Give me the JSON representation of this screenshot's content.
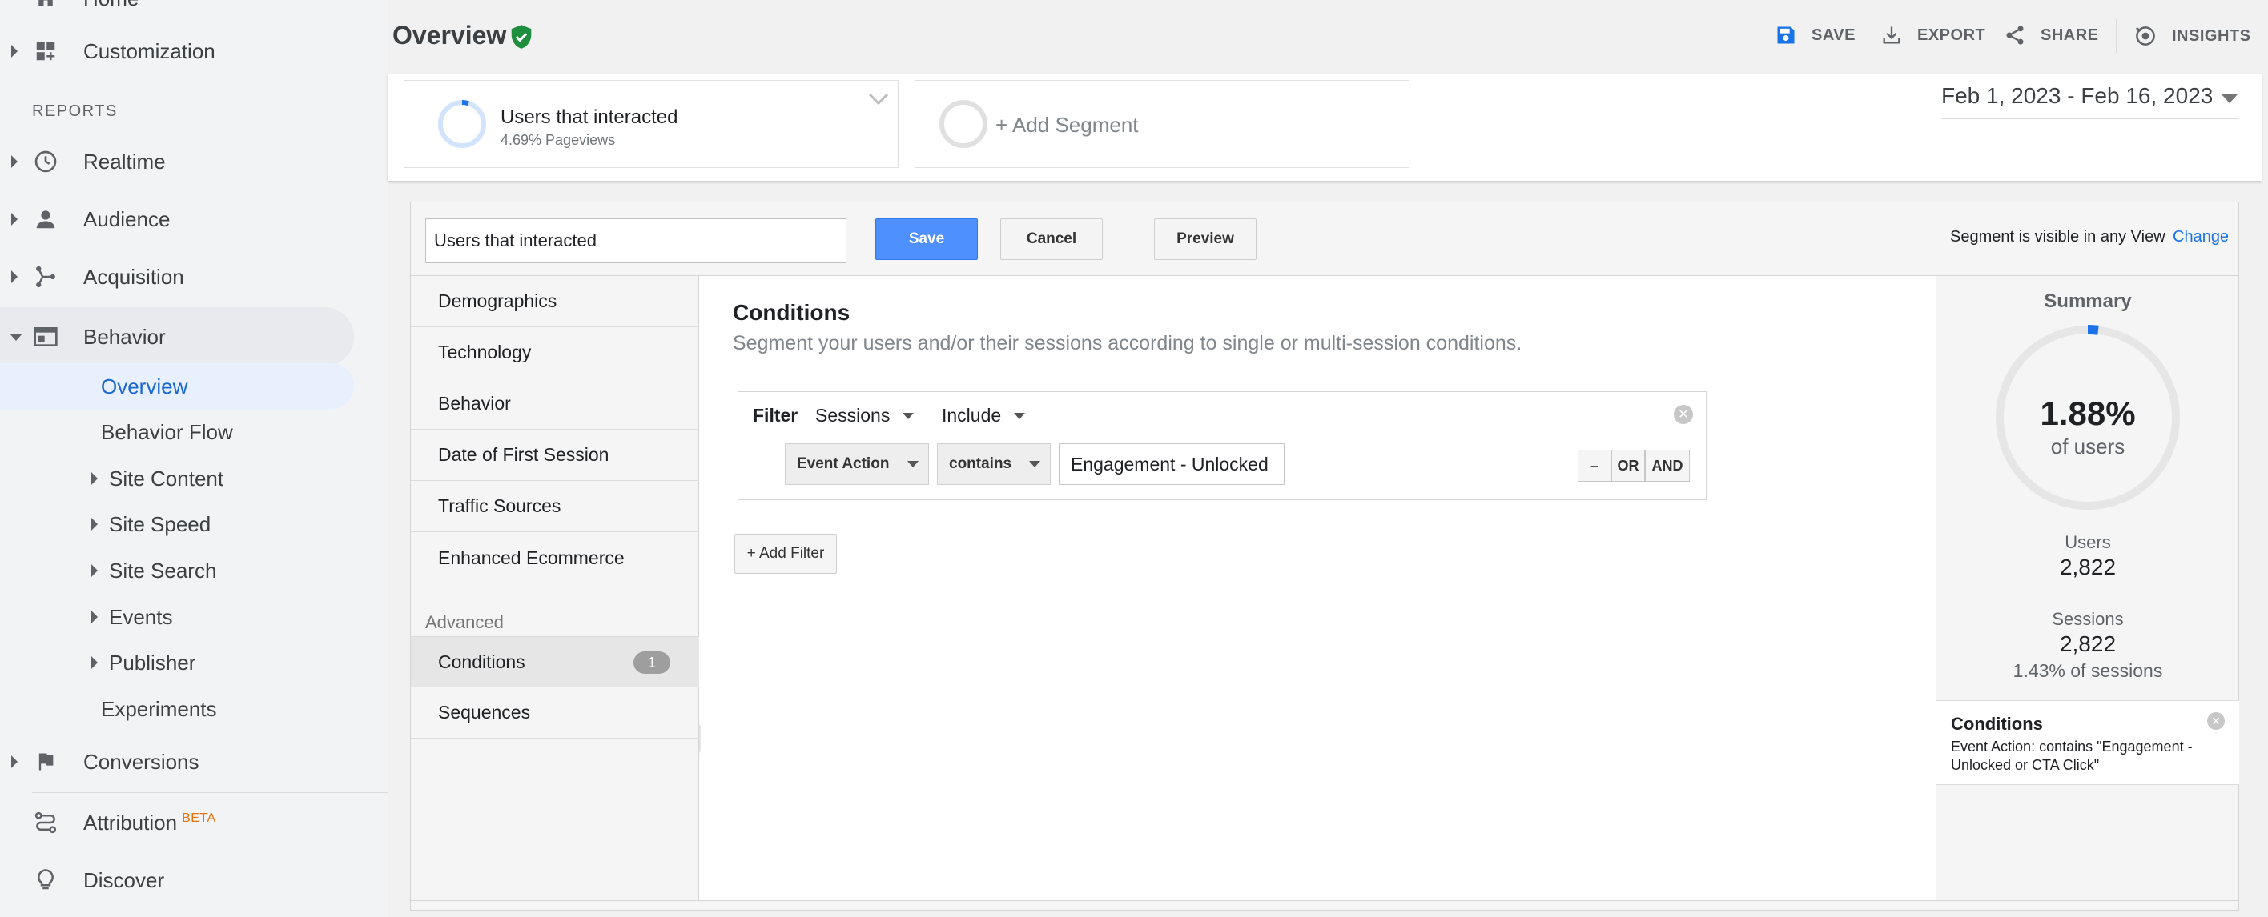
{
  "sidebar": {
    "home_label": "Home",
    "customization_label": "Customization",
    "reports_heading": "REPORTS",
    "realtime_label": "Realtime",
    "audience_label": "Audience",
    "acquisition_label": "Acquisition",
    "behavior_label": "Behavior",
    "behavior_items": [
      {
        "label": "Overview"
      },
      {
        "label": "Behavior Flow"
      },
      {
        "label": "Site Content"
      },
      {
        "label": "Site Speed"
      },
      {
        "label": "Site Search"
      },
      {
        "label": "Events"
      },
      {
        "label": "Publisher"
      },
      {
        "label": "Experiments"
      }
    ],
    "conversions_label": "Conversions",
    "attribution_label": "Attribution",
    "attribution_badge": "BETA",
    "discover_label": "Discover"
  },
  "header": {
    "title": "Overview",
    "tools": {
      "save": "SAVE",
      "export": "EXPORT",
      "share": "SHARE",
      "insights": "INSIGHTS"
    }
  },
  "segments": {
    "active_name": "Users that interacted",
    "active_sub": "4.69% Pageviews",
    "add_label": "+ Add Segment"
  },
  "date_range": "Feb 1, 2023 - Feb 16, 2023",
  "editor": {
    "segment_name": "Users that interacted",
    "save_label": "Save",
    "cancel_label": "Cancel",
    "preview_label": "Preview",
    "visibility_text": "Segment is visible in any View",
    "change_label": "Change",
    "categories": [
      {
        "label": "Demographics"
      },
      {
        "label": "Technology"
      },
      {
        "label": "Behavior"
      },
      {
        "label": "Date of First Session"
      },
      {
        "label": "Traffic Sources"
      },
      {
        "label": "Enhanced Ecommerce"
      }
    ],
    "advanced_heading": "Advanced",
    "advanced_items": [
      {
        "label": "Conditions",
        "count": "1"
      },
      {
        "label": "Sequences"
      }
    ],
    "conditions": {
      "title": "Conditions",
      "description": "Segment your users and/or their sessions according to single or multi-session conditions.",
      "filter_label": "Filter",
      "scope": "Sessions",
      "mode": "Include",
      "dimension": "Event Action",
      "operator": "contains",
      "value": "Engagement - Unlocked",
      "minus_label": "–",
      "or_label": "OR",
      "and_label": "AND",
      "add_filter_label": "+ Add Filter"
    },
    "summary": {
      "title": "Summary",
      "percent": "1.88%",
      "percent_sub": "of users",
      "percent_value": 1.88,
      "users_label": "Users",
      "users_value": "2,822",
      "sessions_label": "Sessions",
      "sessions_value": "2,822",
      "sessions_pct": "1.43% of sessions",
      "conditions_title": "Conditions",
      "conditions_desc": "Event Action: contains \"Engagement - Unlocked or CTA Click\""
    }
  },
  "colors": {
    "accent": "#1a73e8",
    "save_button": "#4d90fe",
    "verified_green": "#1e8e3e",
    "selected_nav_bg": "#e8f0fe",
    "beta": "#e8710a",
    "ring_blue": "#1a73e8"
  }
}
